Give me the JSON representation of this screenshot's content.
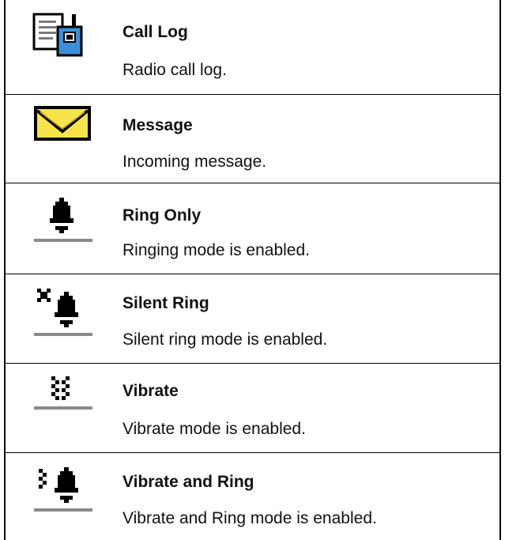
{
  "rows": [
    {
      "title": "Call Log",
      "description": "Radio call log.",
      "icon": "call-log-icon"
    },
    {
      "title": "Message",
      "description": "Incoming message.",
      "icon": "message-envelope-icon"
    },
    {
      "title": "Ring Only",
      "description": "Ringing mode is enabled.",
      "icon": "bell-icon"
    },
    {
      "title": "Silent Ring",
      "description": "Silent ring mode is enabled.",
      "icon": "silent-bell-icon"
    },
    {
      "title": "Vibrate",
      "description": "Vibrate mode is enabled.",
      "icon": "vibrate-icon"
    },
    {
      "title": "Vibrate and Ring",
      "description": "Vibrate and Ring mode is enabled.",
      "icon": "vibrate-bell-icon"
    }
  ],
  "colors": {
    "envelope_fill": "#f7e44a",
    "radio_blue": "#3a8fd8",
    "icon_gray": "#8a8a8a",
    "icon_dark": "#000000"
  }
}
